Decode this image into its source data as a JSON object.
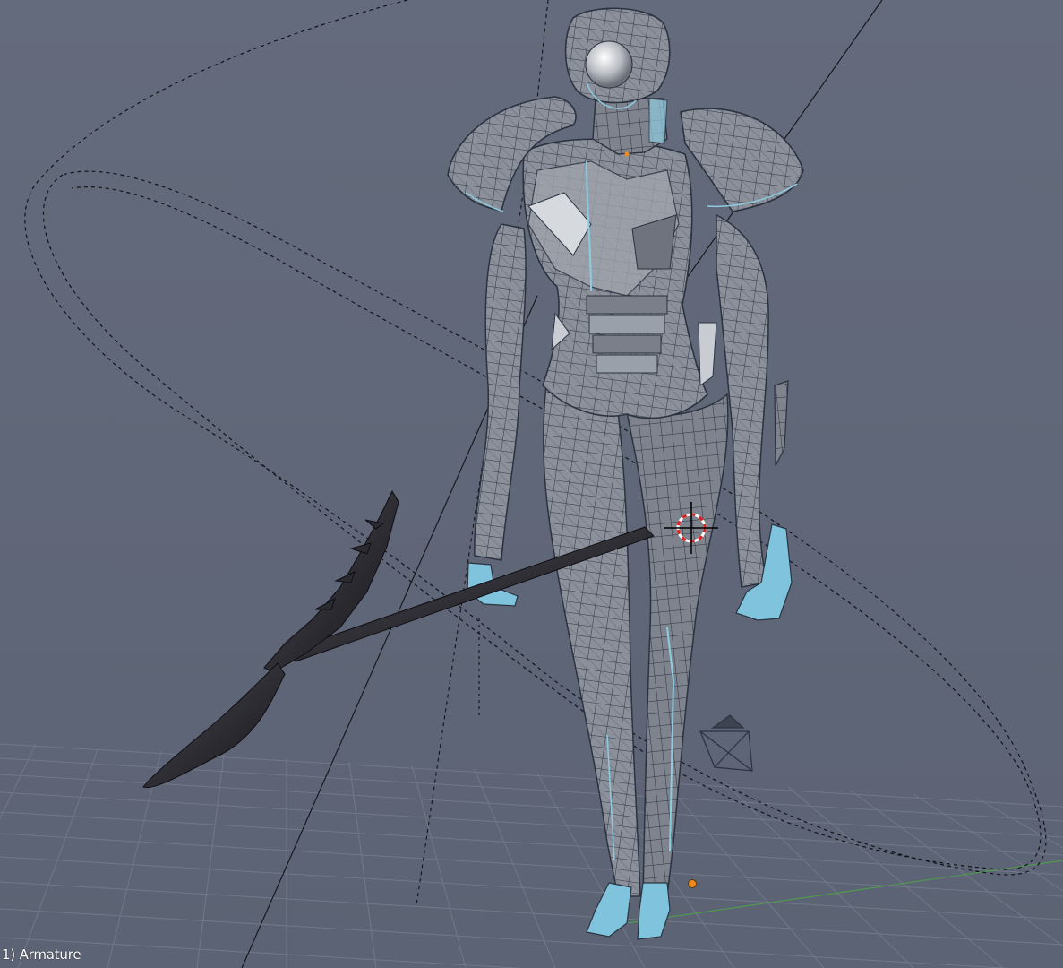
{
  "viewport": {
    "object_label": "1) Armature",
    "view_type": "3D perspective viewport",
    "background_color": "#5f6678"
  },
  "scene": {
    "mesh_color": "#8a8f98",
    "wire_color": "#2c3440",
    "edge_highlight_color": "#8ecbe0",
    "spear_color": "#222228",
    "grid_color": "#747b8b",
    "cursor_colors": [
      "#ff2a2a",
      "#ffffff"
    ],
    "origin_dot_color": "#f08a1e"
  }
}
